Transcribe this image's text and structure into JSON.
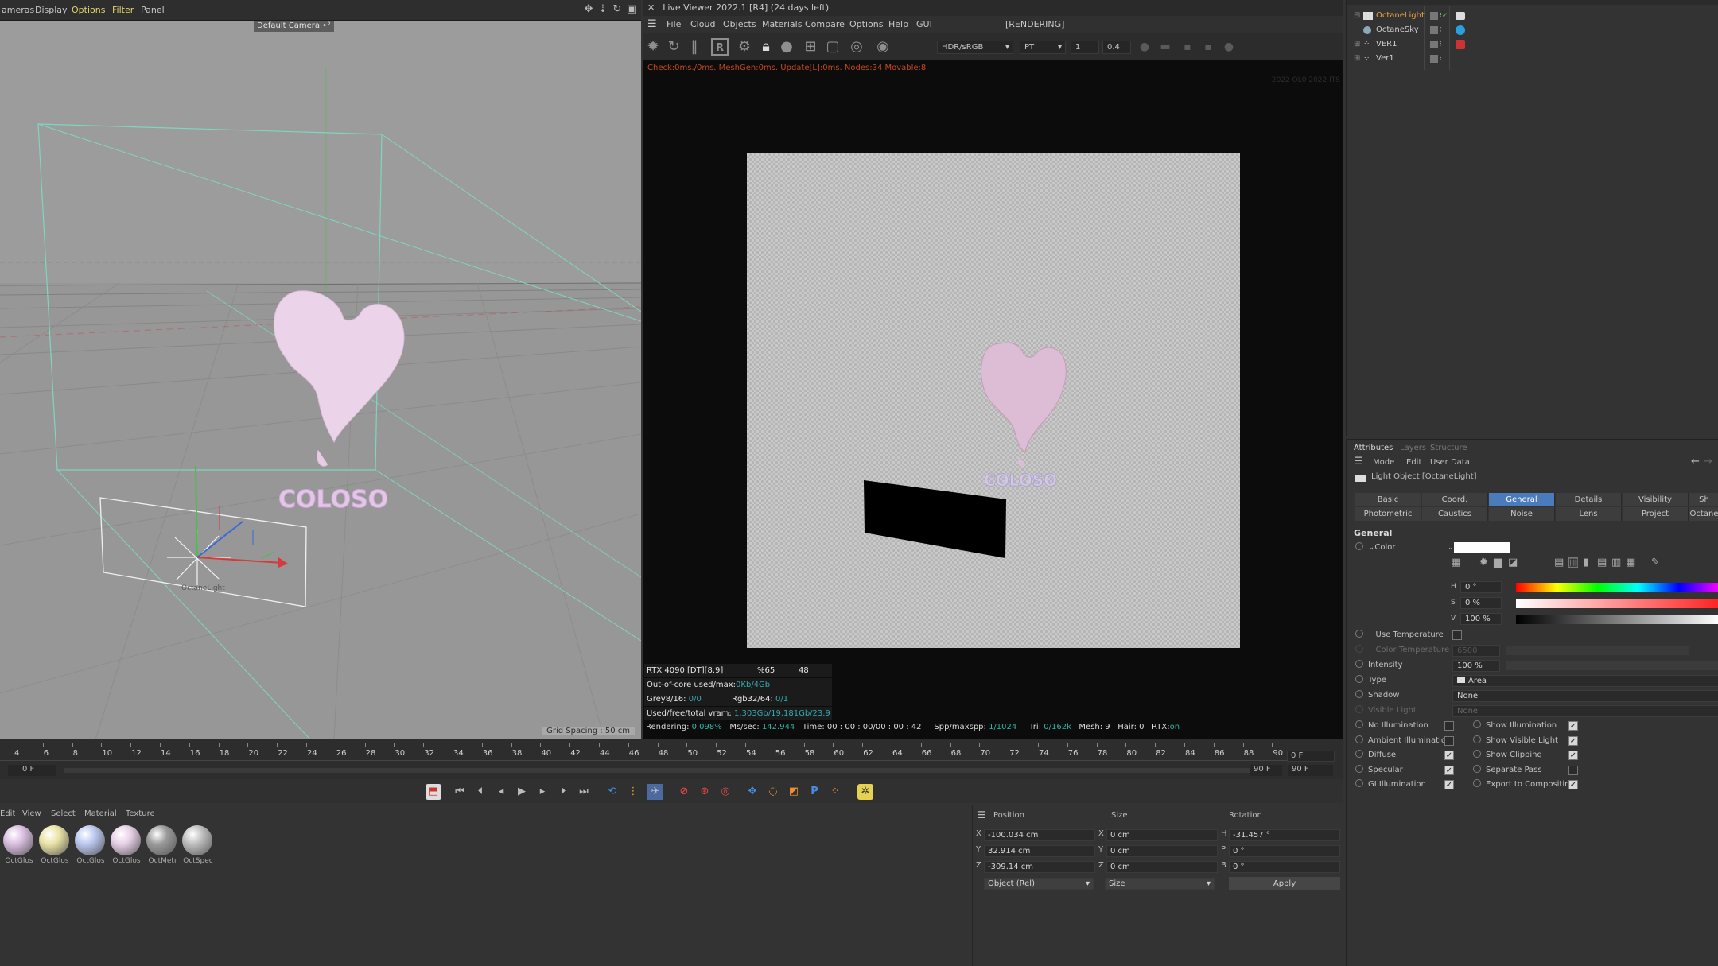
{
  "viewport": {
    "menu": [
      "ameras",
      "Display",
      "Options",
      "Filter",
      "Panel"
    ],
    "camera_label": "Default Camera •°",
    "grid_spacing": "Grid Spacing : 50 cm",
    "light_label": "OctaneLight",
    "text_label": "COLOSO"
  },
  "live_viewer": {
    "title": "Live Viewer 2022.1 [R4] (24 days left)",
    "menu": [
      "File",
      "Cloud",
      "Objects",
      "Materials",
      "Compare",
      "Options",
      "Help",
      "GUI"
    ],
    "status_tag": "[RENDERING]",
    "color_space": "HDR/sRGB",
    "kernel": "PT",
    "value1": "1",
    "value2": "0.4",
    "stats_line": "Check:0ms./0ms. MeshGen:0ms. Update[L]:0ms. Nodes:34 Movable:8",
    "corner_info": "2022 OL0 2022 ITS",
    "render_text": "COLOSO",
    "gpu": {
      "name": "RTX 4090 [DT][8.9]",
      "usage": "%65",
      "temp": "48",
      "out_of_core_label": "Out-of-core used/max:",
      "out_of_core_value": "0Kb/4Gb",
      "grey_label": "Grey8/16:",
      "grey_value": "0/0",
      "rgb_label": "Rgb32/64:",
      "rgb_value": "0/1",
      "vram_label": "Used/free/total vram:",
      "vram_value": "1.303Gb/19.181Gb/23.9"
    },
    "status": {
      "rendering_label": "Rendering:",
      "rendering_value": "0.098%",
      "ms_label": "Ms/sec:",
      "ms_value": "142.944",
      "time_label": "Time:",
      "time_value": "00 : 00 : 00/00 : 00 : 42",
      "spp_label": "Spp/maxspp:",
      "spp_value": "1/1024",
      "tri_label": "Tri:",
      "tri_value": "0/162k",
      "mesh": "Mesh: 9",
      "hair": "Hair: 0",
      "rtx_label": "RTX:",
      "rtx_value": "on"
    }
  },
  "object_manager": {
    "rows": [
      {
        "name": "OctaneLight"
      },
      {
        "name": "OctaneSky"
      },
      {
        "name": "VER1"
      },
      {
        "name": "Ver1"
      }
    ]
  },
  "attributes": {
    "tabs_top": [
      "Attributes",
      "Layers",
      "Structure"
    ],
    "menu": [
      "Mode",
      "Edit",
      "User Data"
    ],
    "object_title": "Light Object [OctaneLight]",
    "tabs_row1": [
      "Basic",
      "Coord.",
      "General",
      "Details",
      "Visibility",
      "Sh"
    ],
    "tabs_row2": [
      "Photometric",
      "Caustics",
      "Noise",
      "Lens",
      "Project",
      "Octane"
    ],
    "active_tab": "General",
    "section": "General",
    "color_label": "Color",
    "hsv": [
      {
        "label": "H",
        "value": "0 °"
      },
      {
        "label": "S",
        "value": "0 %"
      },
      {
        "label": "V",
        "value": "100 %"
      }
    ],
    "use_temperature": "Use Temperature",
    "color_temperature": "Color Temperature",
    "color_temperature_value": "6500",
    "intensity_label": "Intensity",
    "intensity_value": "100 %",
    "type_label": "Type",
    "type_value": "Area",
    "shadow_label": "Shadow",
    "shadow_value": "None",
    "visible_light_label": "Visible Light",
    "visible_light_value": "None",
    "checks_left": [
      {
        "label": "No Illumination",
        "checked": false
      },
      {
        "label": "Ambient Illumination",
        "checked": false
      },
      {
        "label": "Diffuse",
        "checked": true
      },
      {
        "label": "Specular",
        "checked": true
      },
      {
        "label": "GI Illumination",
        "checked": true
      }
    ],
    "checks_right": [
      {
        "label": "Show Illumination",
        "checked": true
      },
      {
        "label": "Show Visible Light",
        "checked": true
      },
      {
        "label": "Show Clipping",
        "checked": true
      },
      {
        "label": "Separate Pass",
        "checked": false
      },
      {
        "label": "Export to Compositing",
        "checked": true
      }
    ]
  },
  "timeline": {
    "ticks": [
      "4",
      "6",
      "8",
      "10",
      "12",
      "14",
      "16",
      "18",
      "20",
      "22",
      "24",
      "26",
      "28",
      "30",
      "32",
      "34",
      "36",
      "38",
      "40",
      "42",
      "44",
      "46",
      "48",
      "50",
      "52",
      "54",
      "56",
      "58",
      "60",
      "62",
      "64",
      "66",
      "68",
      "70",
      "72",
      "74",
      "76",
      "78",
      "80",
      "82",
      "84",
      "86",
      "88",
      "90"
    ],
    "current_frame": "0 F",
    "start_frame": "0 F",
    "end_frame": "90 F",
    "end_frame2": "90 F",
    "frame_right": "0 F"
  },
  "materials": {
    "menu": [
      "Edit",
      "View",
      "Select",
      "Material",
      "Texture"
    ],
    "items": [
      {
        "label": "OctGlos",
        "color": "#d9bde0"
      },
      {
        "label": "OctGlos",
        "color": "#e9e2a3"
      },
      {
        "label": "OctGlos",
        "color": "#b9c6ef"
      },
      {
        "label": "OctGlos",
        "color": "#e6cfe6"
      },
      {
        "label": "OctMetı",
        "color": "#9a9a9a"
      },
      {
        "label": "OctSpec",
        "color": "#bdbdbd"
      }
    ]
  },
  "coordinates": {
    "headers": [
      "Position",
      "Size",
      "Rotation"
    ],
    "rows": [
      {
        "axis": "X",
        "pos": "-100.034 cm",
        "saxis": "X",
        "size": "0 cm",
        "raxis": "H",
        "rot": "-31.457 °"
      },
      {
        "axis": "Y",
        "pos": "32.914 cm",
        "saxis": "Y",
        "size": "0 cm",
        "raxis": "P",
        "rot": "0 °"
      },
      {
        "axis": "Z",
        "pos": "-309.14 cm",
        "saxis": "Z",
        "size": "0 cm",
        "raxis": "B",
        "rot": "0 °"
      }
    ],
    "mode": "Object (Rel)",
    "size_mode": "Size",
    "apply": "Apply"
  },
  "colors": {
    "accent": "#4a7bbd",
    "status_orange": "#c3491d",
    "gpu_teal": "#33aab3"
  }
}
